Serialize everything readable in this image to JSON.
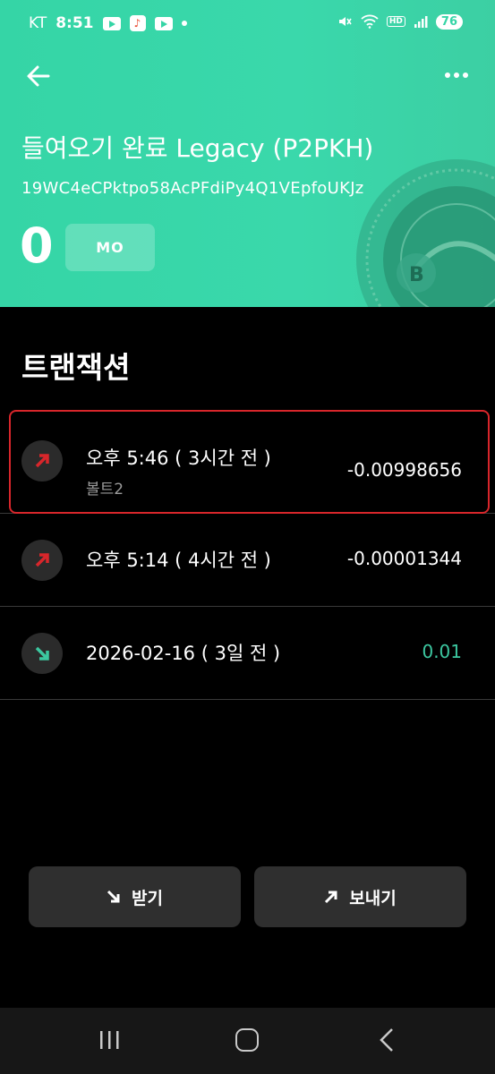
{
  "status_bar": {
    "carrier": "KT",
    "time": "8:51",
    "tiktok_glyph": "♪",
    "hd": "HD",
    "battery": "76"
  },
  "header": {
    "wallet_title": "들여오기 완료 Legacy (P2PKH)",
    "address": "19WC4eCPktpo58AcPFdiPy4Q1VEpfoUKJz",
    "balance": "0",
    "unit_label": "MO",
    "icons": {
      "back": "arrow-left-icon",
      "more": "more-dots-icon"
    },
    "colors": {
      "header_bg": "#38d6a8",
      "negative": "#d8262b",
      "positive": "#3cc7a0"
    }
  },
  "transactions": {
    "title": "트랜잭션",
    "items": [
      {
        "time": "오후 5:46 ( 3시간 전 )",
        "memo": "볼트2",
        "amount": "-0.00998656",
        "direction": "send"
      },
      {
        "time": "오후 5:14 ( 4시간 전 )",
        "memo": "",
        "amount": "-0.00001344",
        "direction": "send"
      },
      {
        "time": "2026-02-16 ( 3일 전 )",
        "memo": "",
        "amount": "0.01",
        "direction": "receive"
      }
    ]
  },
  "actions": {
    "receive_label": "받기",
    "send_label": "보내기"
  }
}
